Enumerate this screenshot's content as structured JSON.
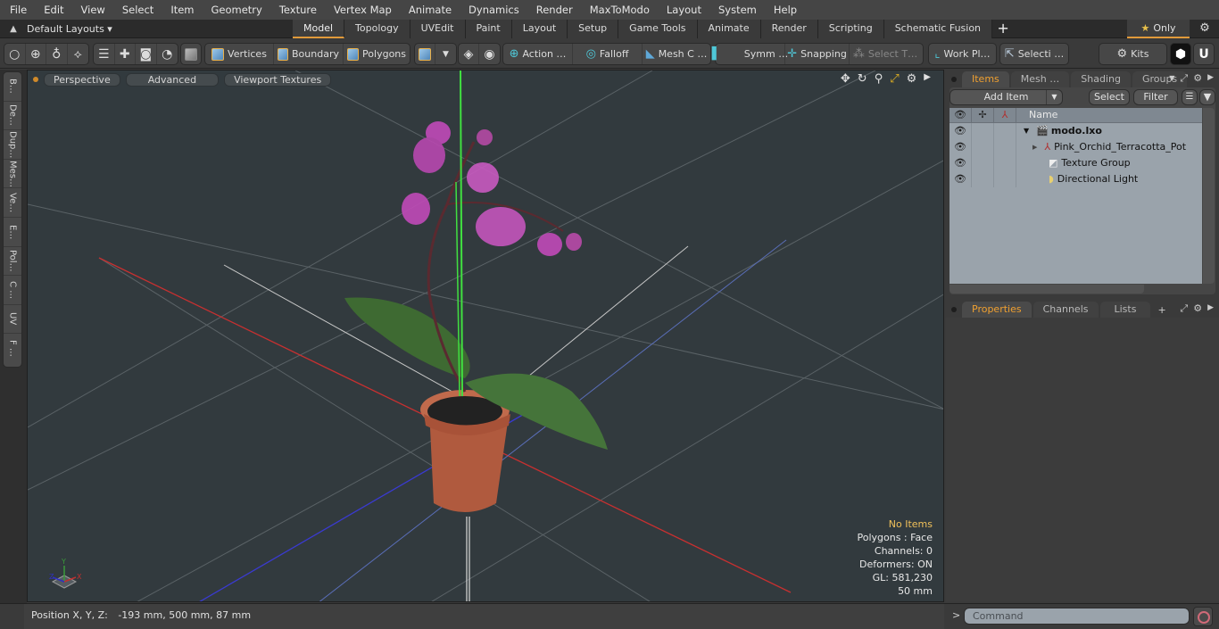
{
  "menu": [
    "File",
    "Edit",
    "View",
    "Select",
    "Item",
    "Geometry",
    "Texture",
    "Vertex Map",
    "Animate",
    "Dynamics",
    "Render",
    "MaxToModo",
    "Layout",
    "System",
    "Help"
  ],
  "layouts": {
    "label": "Default Layouts ▾"
  },
  "tabs": [
    {
      "label": "Model",
      "active": true
    },
    {
      "label": "Topology"
    },
    {
      "label": "UVEdit"
    },
    {
      "label": "Paint"
    },
    {
      "label": "Layout"
    },
    {
      "label": "Setup"
    },
    {
      "label": "Game Tools"
    },
    {
      "label": "Animate"
    },
    {
      "label": "Render"
    },
    {
      "label": "Scripting"
    },
    {
      "label": "Schematic Fusion"
    }
  ],
  "tab_add": "+",
  "only_label": "Only",
  "toolbar": {
    "vertices": "Vertices",
    "boundary": "Boundary",
    "polygons": "Polygons",
    "action": "Action   …",
    "falloff": "Falloff",
    "mesh": "Mesh C …",
    "symm": "Symm …",
    "snapping": "Snapping",
    "select_t": "Select T…",
    "workplane": "Work Pl…",
    "selecti": "Selecti …",
    "kits": "Kits"
  },
  "left_tabs": [
    "B…",
    "De…",
    "Dup…",
    "Mes…",
    "Ve…",
    "E…",
    "Pol…",
    "C …",
    "UV",
    "F …"
  ],
  "viewport": {
    "perspective": "Perspective",
    "advanced": "Advanced",
    "textures": "Viewport Textures",
    "info": {
      "selection": "No Items",
      "polygons": "Polygons : Face",
      "channels": "Channels: 0",
      "deformers": "Deformers: ON",
      "gl": "GL: 581,230",
      "scale": "50 mm"
    }
  },
  "items_panel": {
    "tabs": [
      {
        "label": "Items",
        "active": true
      },
      {
        "label": "Mesh …"
      },
      {
        "label": "Shading"
      },
      {
        "label": "Groups"
      }
    ],
    "add_item": "Add Item",
    "select": "Select",
    "filter": "Filter",
    "col_name": "Name",
    "rows": [
      {
        "name": "modo.lxo",
        "icon": "scene-icon",
        "bold": true
      },
      {
        "name": "Pink_Orchid_Terracotta_Pot",
        "icon": "mesh-locator-icon"
      },
      {
        "name": "Texture Group",
        "icon": "texture-group-icon"
      },
      {
        "name": "Directional Light",
        "icon": "light-icon"
      }
    ]
  },
  "props_panel": {
    "tabs": [
      {
        "label": "Properties",
        "active": true
      },
      {
        "label": "Channels"
      },
      {
        "label": "Lists"
      }
    ],
    "add": "+"
  },
  "status": {
    "position_label": "Position X, Y, Z:",
    "position_value": "-193 mm, 500 mm, 87 mm",
    "command_placeholder": "Command",
    "prompt": ">"
  }
}
